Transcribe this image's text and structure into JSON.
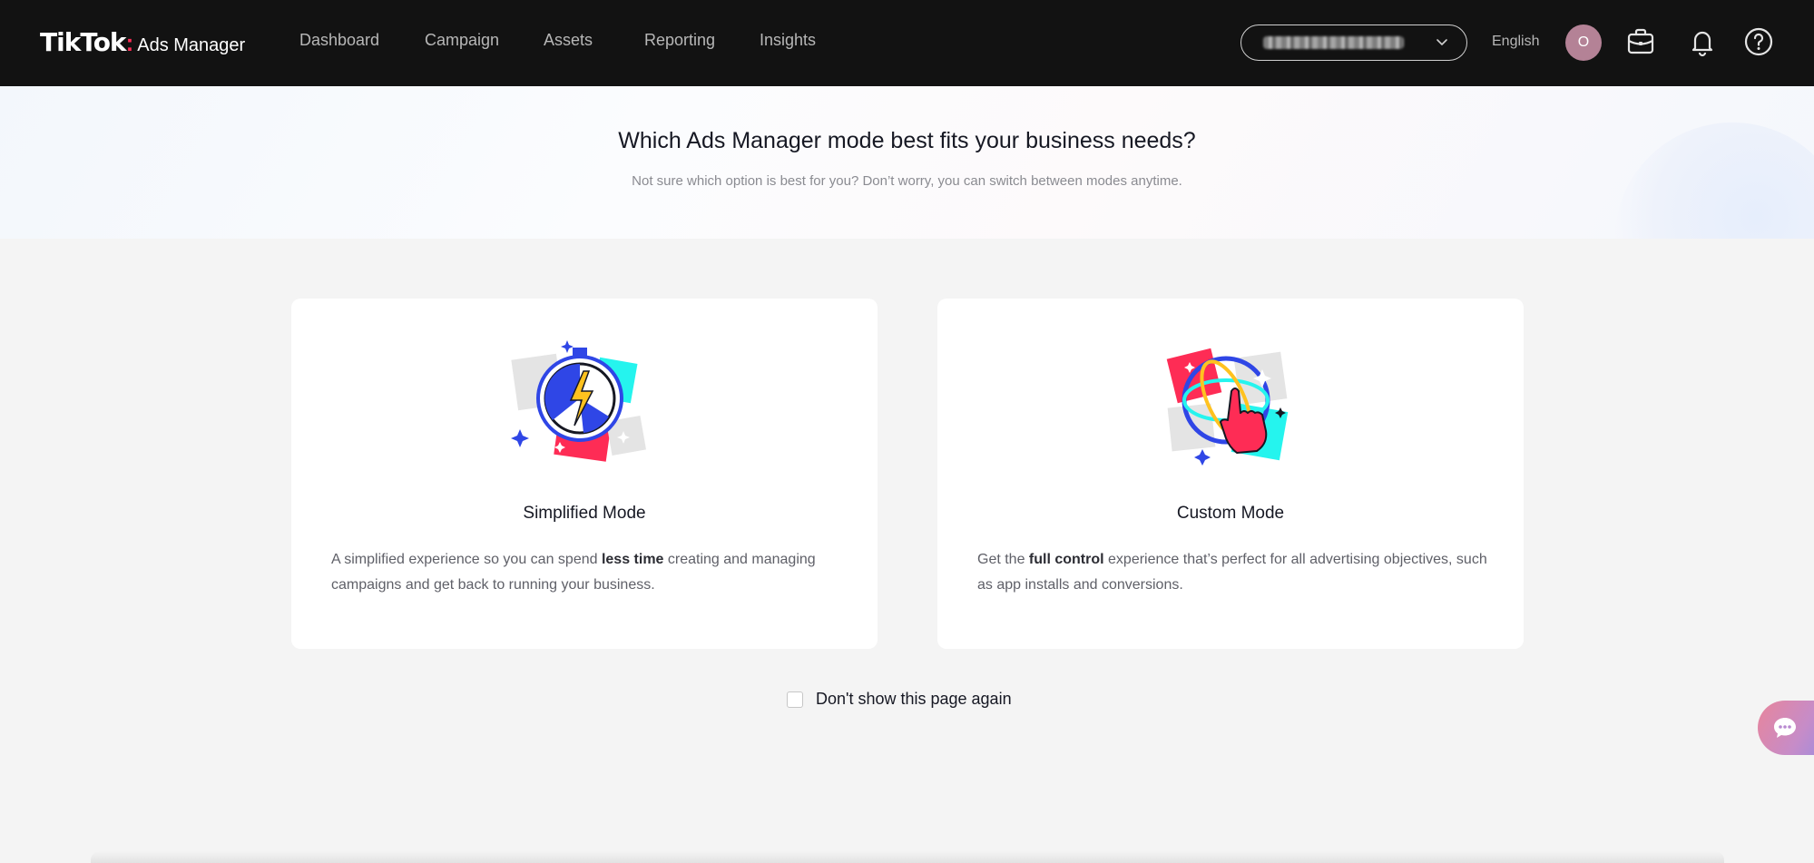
{
  "header": {
    "logo_main": "TikTok",
    "logo_dot": ":",
    "logo_sub": "Ads Manager",
    "nav": [
      "Dashboard",
      "Campaign",
      "Assets",
      "Reporting",
      "Insights"
    ],
    "language": "English",
    "avatar_initial": "O",
    "icons": [
      "chevron-down-icon",
      "briefcase-icon",
      "bell-icon",
      "help-icon"
    ]
  },
  "hero": {
    "title": "Which Ads Manager mode best fits your business needs?",
    "subtitle": "Not sure which option is best for you? Don’t worry, you can switch between modes anytime."
  },
  "modes": [
    {
      "title": "Simplified Mode",
      "desc_pre": "A simplified experience so you can spend ",
      "desc_bold": "less time",
      "desc_post": " creating and managing campaigns and get back to running your business.",
      "icon": "stopwatch-lightning-icon"
    },
    {
      "title": "Custom Mode",
      "desc_pre": "Get the ",
      "desc_bold": "full control",
      "desc_post": " experience that’s perfect for all advertising objectives, such as app installs and conversions.",
      "icon": "globe-hand-icon"
    }
  ],
  "dont_show": {
    "label": "Don't show this page again",
    "checked": false
  },
  "colors": {
    "topbar": "#121212",
    "brand_red": "#fe2c55",
    "brand_cyan": "#25f4ee",
    "accent_blue": "#2f46e6"
  }
}
